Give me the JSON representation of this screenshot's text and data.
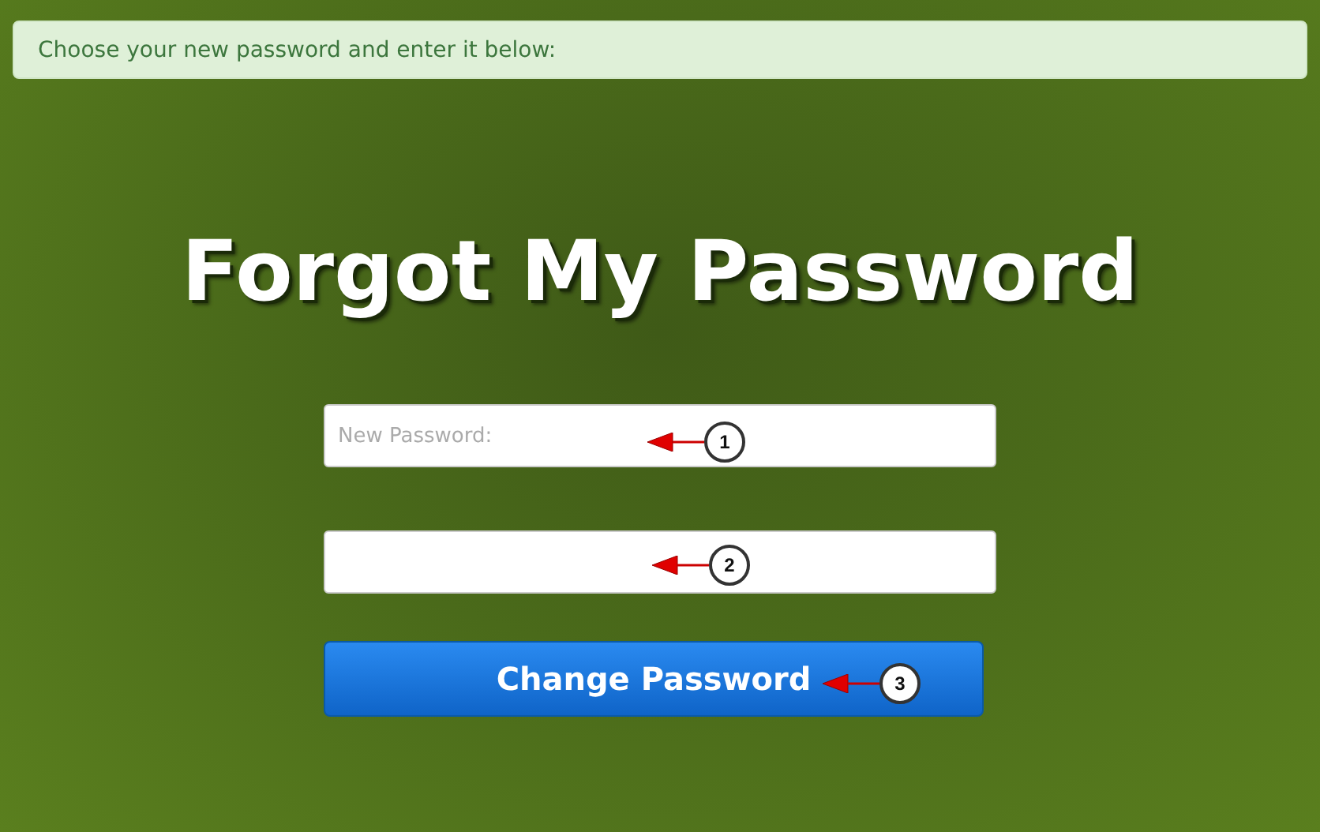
{
  "alert": {
    "text": "Choose your new password and enter it below:"
  },
  "title": "Forgot My Password",
  "fields": [
    {
      "kind": "input",
      "placeholder": "New Password:"
    },
    {
      "kind": "input"
    }
  ],
  "button": {
    "label": "Change Password"
  },
  "callouts": [
    {
      "number": "1"
    },
    {
      "number": "2"
    },
    {
      "number": "3"
    }
  ]
}
